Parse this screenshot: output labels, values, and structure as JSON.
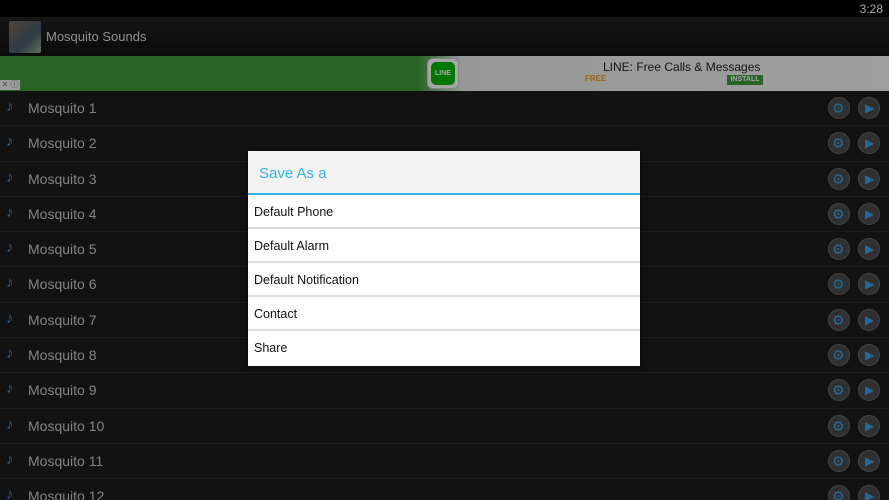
{
  "status_bar": {
    "time": "3:28"
  },
  "action_bar": {
    "title": "Mosquito Sounds"
  },
  "ad": {
    "close_label": "✕ ⓘ",
    "logo_text": "LINE",
    "title": "LINE: Free Calls & Messages",
    "free_label": "FREE",
    "install_label": "INSTALL"
  },
  "list": {
    "items": [
      {
        "label": "Mosquito 1"
      },
      {
        "label": "Mosquito 2"
      },
      {
        "label": "Mosquito 3"
      },
      {
        "label": "Mosquito 4"
      },
      {
        "label": "Mosquito 5"
      },
      {
        "label": "Mosquito 6"
      },
      {
        "label": "Mosquito 7"
      },
      {
        "label": "Mosquito 8"
      },
      {
        "label": "Mosquito 9"
      },
      {
        "label": "Mosquito 10"
      },
      {
        "label": "Mosquito 11"
      },
      {
        "label": "Mosquito 12"
      }
    ],
    "icons": {
      "item": "music-note-icon",
      "settings": "gear-icon",
      "play": "play-icon"
    }
  },
  "dialog": {
    "title": "Save As a",
    "options": [
      {
        "label": "Default Phone"
      },
      {
        "label": "Default Alarm"
      },
      {
        "label": "Default Notification"
      },
      {
        "label": "Contact"
      },
      {
        "label": "Share"
      }
    ]
  },
  "colors": {
    "accent": "#33b5e5",
    "ad_green": "#3d9a3a",
    "list_bg": "#1d1d1d"
  }
}
